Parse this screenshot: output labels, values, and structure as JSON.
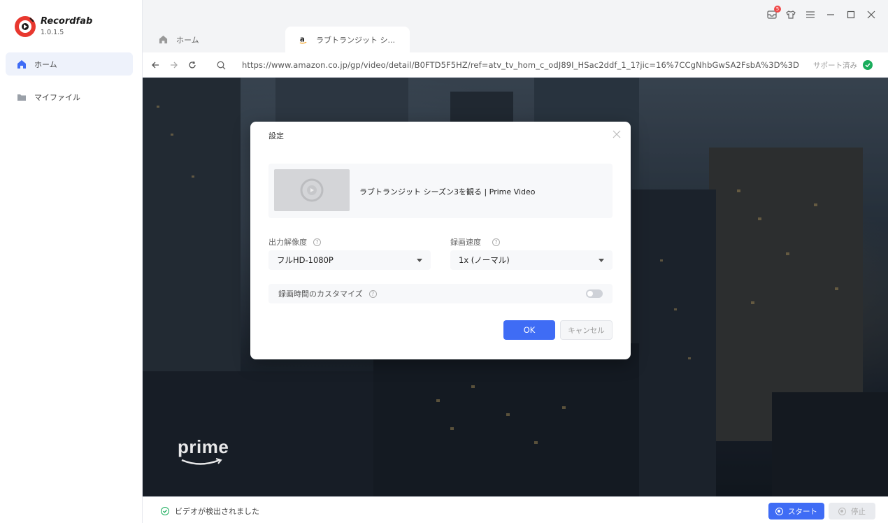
{
  "app": {
    "name": "Recordfab",
    "version": "1.0.1.5",
    "notification_count": "5"
  },
  "sidebar": {
    "items": [
      {
        "label": "ホーム",
        "icon": "home-icon",
        "active": true
      },
      {
        "label": "マイファイル",
        "icon": "folder-icon",
        "active": false
      }
    ]
  },
  "tabs": [
    {
      "label": "ホーム",
      "icon": "home-icon"
    },
    {
      "label": "ラブトランジット シ...",
      "icon": "amazon-icon"
    }
  ],
  "addressbar": {
    "url": "https://www.amazon.co.jp/gp/video/detail/B0FTD5F5HZ/ref=atv_tv_hom_c_odJ89I_HSac2ddf_1_1?jic=16%7CCgNhbGwSA2FsbA%3D%3D",
    "support_label": "サポート済み"
  },
  "dialog": {
    "title": "設定",
    "video_title": "ラブトランジット シーズン3を観る | Prime Video",
    "resolution_label": "出力解像度",
    "resolution_value": "フルHD-1080P",
    "speed_label": "録画速度",
    "speed_value": "1x (ノーマル)",
    "custom_time_label": "録画時間のカスタマイズ",
    "custom_time_enabled": false,
    "ok_label": "OK",
    "cancel_label": "キャンセル"
  },
  "background": {
    "brand_label": "prime"
  },
  "statusbar": {
    "status_text": "ビデオが検出されました",
    "start_label": "スタート",
    "stop_label": "停止"
  },
  "colors": {
    "accent": "#3f6cf5",
    "success": "#1aad5c",
    "brand_red": "#e8382f"
  }
}
